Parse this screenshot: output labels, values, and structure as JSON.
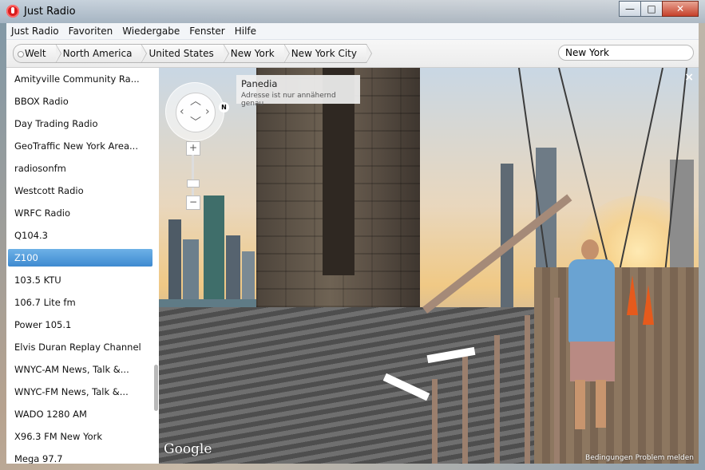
{
  "window": {
    "title": "Just Radio",
    "controls": {
      "minimize": "—",
      "maximize": "□",
      "close": "✕"
    }
  },
  "menu": [
    "Just Radio",
    "Favoriten",
    "Wiedergabe",
    "Fenster",
    "Hilfe"
  ],
  "breadcrumb": [
    "Welt",
    "North America",
    "United States",
    "New York",
    "New York City"
  ],
  "search": {
    "value": "New York"
  },
  "stations": [
    "Amityville Community Ra...",
    "BBOX Radio",
    "Day Trading Radio",
    "GeoTraffic New York Area...",
    "radiosonfm",
    "Westcott Radio",
    "WRFC Radio",
    "Q104.3",
    "Z100",
    "103.5 KTU",
    "106.7 Lite fm",
    "Power 105.1",
    "Elvis Duran Replay Channel",
    "WNYC-AM News, Talk &...",
    "WNYC-FM News, Talk &...",
    "WADO 1280 AM",
    "X96.3 FM New York",
    "Mega 97.7"
  ],
  "selected_station_index": 8,
  "streetview": {
    "poi_title": "Panedia",
    "poi_subtitle": "Adresse ist nur annähernd genau",
    "compass_north": "N",
    "zoom_in": "+",
    "zoom_out": "−",
    "brand": "Google",
    "footer": "Bedingungen   Problem melden",
    "close": "×"
  }
}
